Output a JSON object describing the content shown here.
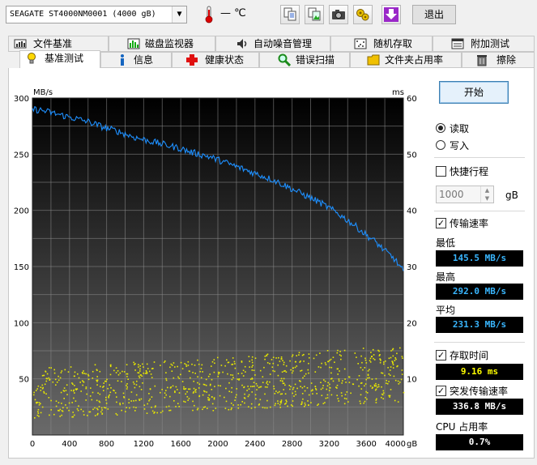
{
  "toolbar": {
    "drive": "SEAGATE ST4000NM0001 (4000 gB)",
    "temp": "— ℃",
    "exit_label": "退出",
    "icons": [
      "copy-text-icon",
      "copy-image-icon",
      "screenshot-icon",
      "options-icon",
      "download-icon"
    ]
  },
  "tabs_top": [
    {
      "label": "文件基准",
      "icon": "file-benchmark-icon"
    },
    {
      "label": "磁盘监视器",
      "icon": "disk-monitor-icon"
    },
    {
      "label": "自动噪音管理",
      "icon": "speaker-icon"
    },
    {
      "label": "随机存取",
      "icon": "random-access-icon"
    },
    {
      "label": "附加测试",
      "icon": "extra-tests-icon"
    }
  ],
  "tabs_bottom": [
    {
      "label": "基准测试",
      "icon": "lightbulb-icon",
      "active": true
    },
    {
      "label": "信息",
      "icon": "info-icon"
    },
    {
      "label": "健康状态",
      "icon": "health-cross-icon"
    },
    {
      "label": "错误扫描",
      "icon": "magnifier-icon"
    },
    {
      "label": "文件夹占用率",
      "icon": "folder-icon"
    },
    {
      "label": "擦除",
      "icon": "trash-icon"
    }
  ],
  "panel": {
    "start_label": "开始",
    "read_label": "读取",
    "write_label": "写入",
    "short_stroke_label": "快捷行程",
    "short_stroke_value": "1000",
    "short_stroke_unit": "gB",
    "transfer_rate_label": "传输速率",
    "min_label": "最低",
    "min_value": "145.5 MB/s",
    "max_label": "最高",
    "max_value": "292.0 MB/s",
    "avg_label": "平均",
    "avg_value": "231.3 MB/s",
    "access_time_label": "存取时间",
    "access_time_value": "9.16 ms",
    "burst_label": "突发传输速率",
    "burst_value": "336.8 MB/s",
    "cpu_label": "CPU 占用率",
    "cpu_value": "0.7%",
    "colors": {
      "readout_blue": "#39b6ff",
      "readout_yellow": "#ffff00",
      "readout_white": "#ffffff"
    }
  },
  "chart_data": {
    "type": "line",
    "ylabel_left": "MB/s",
    "ylabel_right": "ms",
    "xunit": "gB",
    "xlim": [
      0,
      4000
    ],
    "ylim_left": [
      0,
      300
    ],
    "ylim_right": [
      0,
      60
    ],
    "xticks": [
      "0",
      "400",
      "800",
      "1200",
      "1600",
      "2000",
      "2400",
      "2800",
      "3200",
      "3600",
      "4000"
    ],
    "yticks_left": [
      "0",
      "50",
      "100",
      "150",
      "200",
      "250",
      "300"
    ],
    "yticks_right": [
      "0",
      "10",
      "20",
      "30",
      "40",
      "50",
      "60"
    ],
    "grid": true,
    "series": [
      {
        "color": "#1e90ff",
        "axis": "left",
        "x": [
          0,
          100,
          200,
          300,
          400,
          500,
          600,
          700,
          800,
          900,
          1000,
          1100,
          1200,
          1300,
          1400,
          1500,
          1600,
          1700,
          1800,
          1900,
          2000,
          2100,
          2200,
          2300,
          2400,
          2500,
          2600,
          2700,
          2800,
          2900,
          3000,
          3100,
          3200,
          3300,
          3400,
          3500,
          3600,
          3700,
          3800,
          3900,
          4000
        ],
        "y": [
          290,
          289,
          287,
          285,
          283,
          281,
          279,
          276,
          273,
          271,
          268,
          265,
          263,
          261,
          259,
          257,
          255,
          252,
          250,
          248,
          245,
          242,
          239,
          236,
          233,
          230,
          227,
          223,
          219,
          215,
          211,
          207,
          202,
          197,
          191,
          185,
          178,
          172,
          164,
          157,
          146
        ]
      },
      {
        "color": "#e8e800",
        "axis": "right",
        "x_range": [
          0,
          4000
        ],
        "y_start_range": [
          3,
          12
        ],
        "y_end_range": [
          6,
          16
        ],
        "count": 900
      }
    ]
  }
}
